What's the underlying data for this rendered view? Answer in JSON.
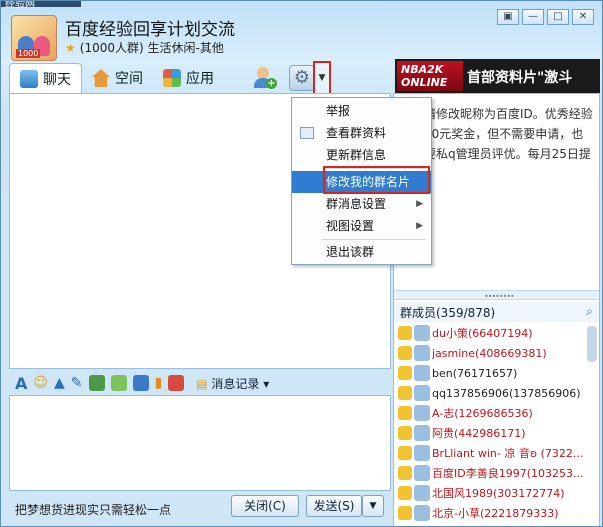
{
  "window": {
    "title": "百度经验回享计划交流",
    "subtitle": "(1000人群) 生活休闲-其他",
    "topstrip_text": "经验网",
    "controls": [
      "▣",
      "—",
      "□",
      "✕"
    ]
  },
  "tabs": [
    {
      "label": "聊天",
      "icon": "chat-icon"
    },
    {
      "label": "空间",
      "icon": "home-icon"
    },
    {
      "label": "应用",
      "icon": "apps-icon"
    }
  ],
  "banner": {
    "logo_line1": "NBA2K",
    "logo_line2": "ONLINE",
    "text": "首部资料片\"激斗"
  },
  "notice": {
    "text": "入群请修改昵称为百度ID。优秀经验可获50元奖金，但不需要申请，也请不要私q管理员评优。每月25日提交"
  },
  "members": {
    "header": "群成员(359/878)",
    "list": [
      "du小策(66407194)",
      "jasmine(408669381)",
      "ben(76171657)",
      "qq137856906(137856906)",
      "A-志(1269686536)",
      "阿贵(442986171)",
      "BrLliant win- 凉 音ʚ (7322...",
      "百度ID李善良1997(103253...",
      "北国风1989(303172774)",
      "北京-小草(2221879333)"
    ]
  },
  "menu": {
    "items": [
      {
        "label": "举报",
        "submenu": false
      },
      {
        "label": "查看群资料",
        "submenu": false
      },
      {
        "label": "更新群信息",
        "submenu": false
      },
      {
        "label": "修改我的群名片",
        "submenu": false,
        "highlighted": true
      },
      {
        "label": "群消息设置",
        "submenu": true
      },
      {
        "label": "视图设置",
        "submenu": true
      },
      {
        "label": "退出该群",
        "submenu": false
      }
    ]
  },
  "toolbar": {
    "history_label": "消息记录"
  },
  "footer": {
    "slogan": "把梦想货进现实只需轻松一点",
    "close_label": "关闭(C)",
    "send_label": "发送(S)"
  },
  "colors": {
    "highlight": "#2f7cd1",
    "annotation_red": "#d9251c"
  }
}
